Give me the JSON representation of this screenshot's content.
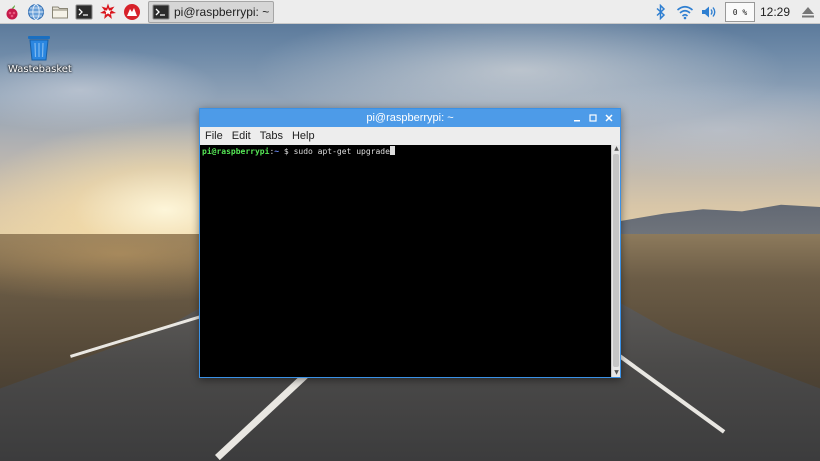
{
  "desktop": {
    "wastebasket_label": "Wastebasket"
  },
  "panel": {
    "launchers": [
      {
        "icon": "raspberry-menu-icon"
      },
      {
        "icon": "web-browser-icon"
      },
      {
        "icon": "file-manager-icon"
      },
      {
        "icon": "terminal-icon"
      },
      {
        "icon": "math-kernel-icon"
      },
      {
        "icon": "wolfram-icon"
      }
    ],
    "taskbar": {
      "active_window": "pi@raspberrypi: ~"
    },
    "tray": {
      "cpu_usage": "0 %",
      "clock": "12:29"
    }
  },
  "terminal": {
    "title": "pi@raspberrypi: ~",
    "menus": [
      "File",
      "Edit",
      "Tabs",
      "Help"
    ],
    "prompt_user": "pi@raspberrypi",
    "prompt_sep": ":",
    "prompt_path": "~",
    "prompt_symbol": "$",
    "command": "sudo apt-get upgrade"
  },
  "colors": {
    "titlebar": "#4d9be8",
    "terminal_bg": "#000000",
    "prompt_green": "#55e655",
    "path_blue": "#6f8fff"
  }
}
